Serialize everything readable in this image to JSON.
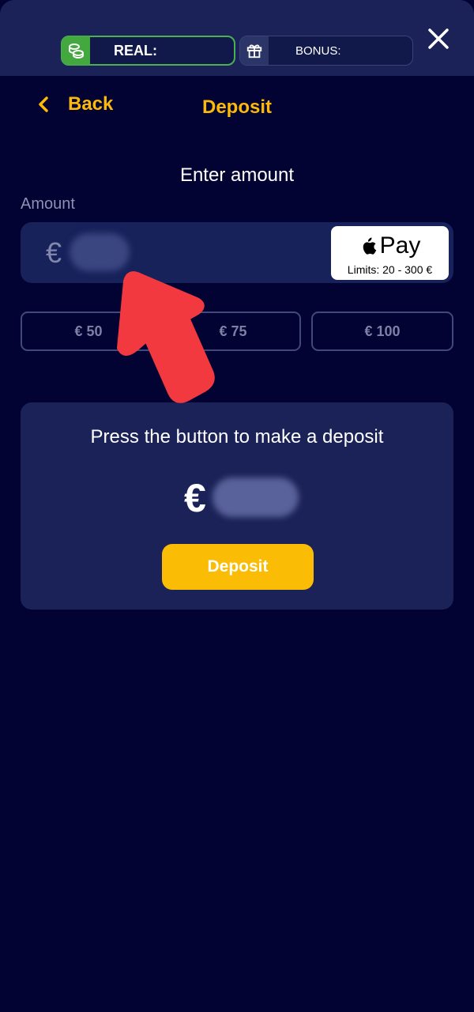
{
  "header": {
    "real_label": "REAL:",
    "bonus_label": "BONUS:"
  },
  "nav": {
    "back_label": "Back",
    "title": "Deposit"
  },
  "form": {
    "heading": "Enter amount",
    "amount_label": "Amount",
    "currency_symbol": "€",
    "payment_method": {
      "name": "Pay",
      "limits": "Limits: 20 - 300 €"
    },
    "quick_amounts": [
      "€ 50",
      "€ 75",
      "€ 100"
    ]
  },
  "summary": {
    "instruction": "Press the button to make a deposit",
    "currency_symbol": "€",
    "button_label": "Deposit"
  },
  "colors": {
    "background": "#020233",
    "panel": "#1a2257",
    "accent": "#fbb90c",
    "real_green": "#43a83d",
    "annotation_arrow": "#f2393f"
  },
  "icons": {
    "real": "coins-icon",
    "bonus": "gift-icon",
    "close": "close-icon",
    "back": "chevron-left-icon",
    "apple": "apple-logo-icon",
    "annotation": "arrow-annotation"
  }
}
